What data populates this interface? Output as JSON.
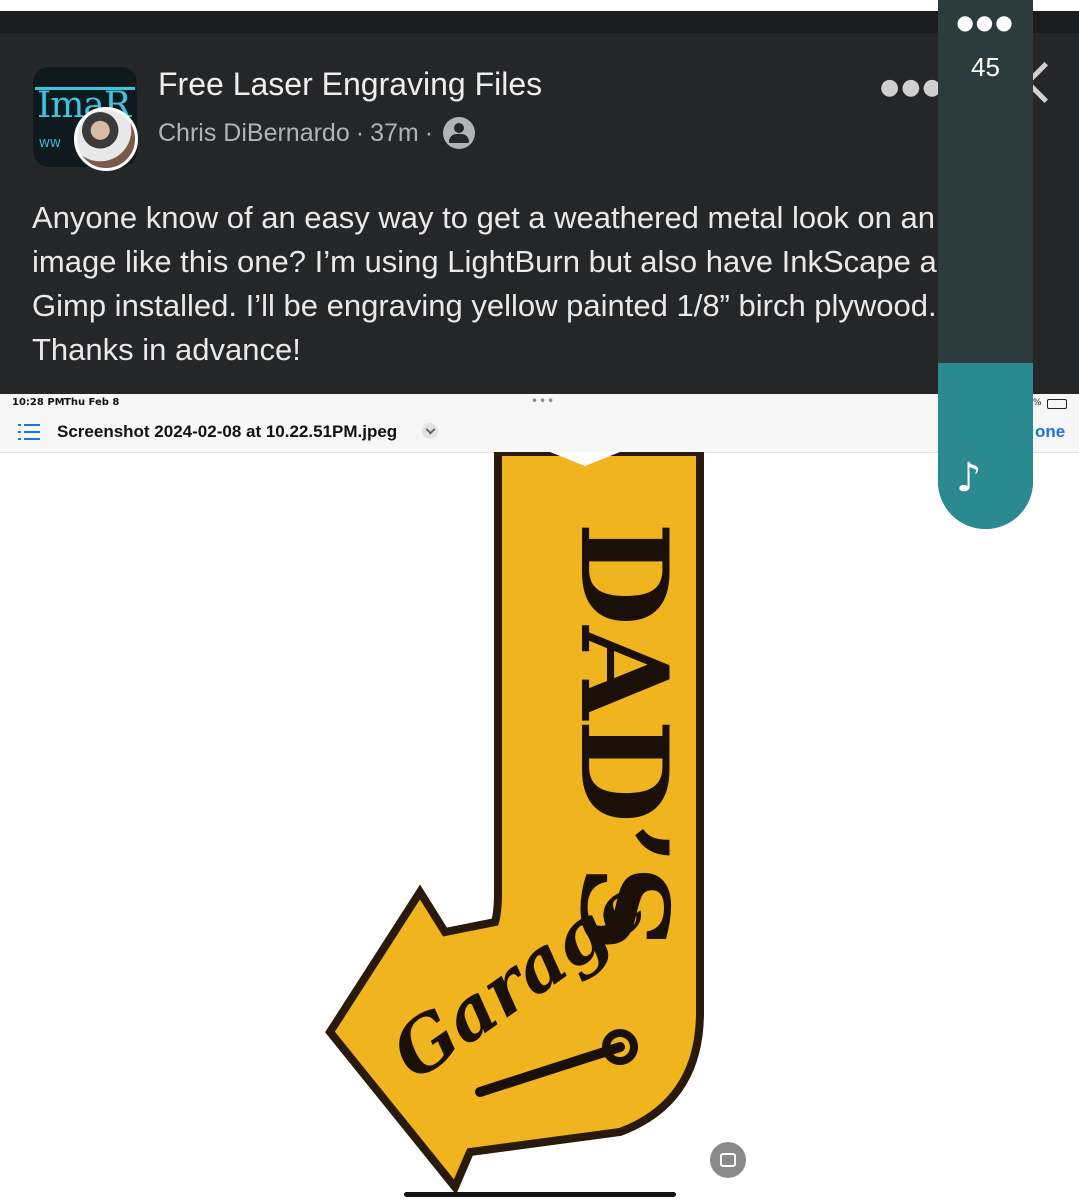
{
  "post": {
    "group_name": "Free Laser Engraving Files",
    "author": "Chris DiBernardo",
    "time": "37m",
    "separator": "·",
    "body_lines": [
      "Anyone know of an easy way to get a weathered metal look on an",
      "image like this one? I’m using LightBurn but also have InkScape and",
      "Gimp installed. I’ll be engraving yellow painted 1/8” birch plywood.",
      "Thanks in advance!"
    ],
    "group_logo_text": "ImaR",
    "group_logo_sub": "WW"
  },
  "screenshot": {
    "status_time": "10:28 PM",
    "status_date": "Thu Feb 8",
    "battery": "%",
    "filename": "Screenshot 2024-02-08 at 10.22.51PM.jpeg",
    "done_label": "one"
  },
  "sign": {
    "line1": "DAD’S",
    "line2": "Garage",
    "colors": {
      "fill": "#f0b41e",
      "outline": "#2a1a0c"
    }
  },
  "volume": {
    "level": 45,
    "menu_icon": "ellipsis-icon",
    "speaker_icon": "music-note-icon",
    "accent": "#2a8a8f"
  }
}
